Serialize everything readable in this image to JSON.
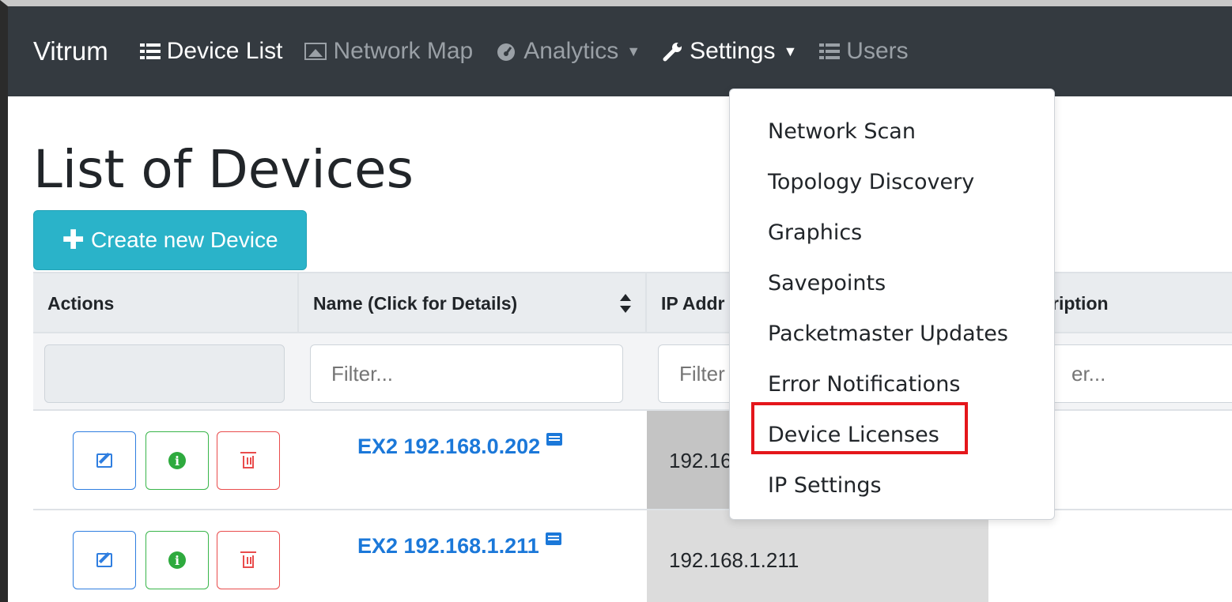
{
  "navbar": {
    "brand": "Vitrum",
    "items": [
      {
        "label": "Device List",
        "icon": "list-icon",
        "active": true
      },
      {
        "label": "Network Map",
        "icon": "image-icon",
        "active": false
      },
      {
        "label": "Analytics",
        "icon": "dashboard-icon",
        "dropdown": true,
        "active": false
      },
      {
        "label": "Settings",
        "icon": "wrench-icon",
        "dropdown": true,
        "active": true
      },
      {
        "label": "Users",
        "icon": "list-icon",
        "active": false
      }
    ]
  },
  "page": {
    "title": "List of Devices",
    "create_button": "Create new Device"
  },
  "table": {
    "headers": [
      "Actions",
      "Name (Click for Details)",
      "IP Addr",
      "ription"
    ],
    "filter_placeholder_name": "Filter...",
    "filter_placeholder_ip": "Filter",
    "filter_placeholder_desc": "er...",
    "rows": [
      {
        "name": "EX2 192.168.0.202",
        "ip": "192.16"
      },
      {
        "name": "EX2 192.168.1.211",
        "ip": "192.168.1.211"
      }
    ]
  },
  "settings_menu": {
    "items": [
      "Network Scan",
      "Topology Discovery",
      "Graphics",
      "Savepoints",
      "Packetmaster Updates",
      "Error Notifications",
      "Device Licenses",
      "IP Settings"
    ],
    "highlighted": "Device Licenses"
  },
  "colors": {
    "navbar_bg": "#343a40",
    "create_button_bg": "#2ab3c9",
    "link": "#1b78d9",
    "highlight": "#e4161b"
  }
}
